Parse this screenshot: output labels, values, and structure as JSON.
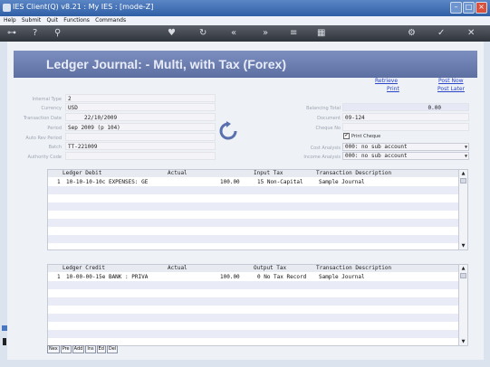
{
  "window": {
    "title": "IES Client(Q) v8.21 : My IES :      [mode-Z]"
  },
  "menu": [
    "Help",
    "Submit",
    "Quit",
    "Functions",
    "Commands"
  ],
  "page": {
    "title": "Ledger Journal: - Multi, with Tax (Forex)"
  },
  "links": {
    "retrieve": "Retrieve",
    "print": "Print",
    "post_now": "Post Now",
    "post_later": "Post Later"
  },
  "form": {
    "internal_type": {
      "label": "Internal Type",
      "value": "2"
    },
    "currency": {
      "label": "Currency",
      "value": "USD"
    },
    "transaction_date": {
      "label": "Transaction Date",
      "value": "22/10/2009"
    },
    "period": {
      "label": "Period",
      "value": "Sep 2009 (p 104)"
    },
    "auto_rev_period": {
      "label": "Auto Rev Period",
      "value": ""
    },
    "batch": {
      "label": "Batch",
      "value": "TT-221009"
    },
    "authority_code": {
      "label": "Authority Code",
      "value": ""
    },
    "balancing_total": {
      "label": "Balancing Total",
      "value": "0.00"
    },
    "document": {
      "label": "Document",
      "value": "09-124"
    },
    "cheque_no": {
      "label": "Cheque No",
      "value": ""
    },
    "print_cheque": {
      "label": "Print Cheque",
      "checked": true,
      "mark": "✔"
    },
    "cost_analysis": {
      "label": "Cost Analysis",
      "value": "000: no sub account"
    },
    "income_analysis": {
      "label": "Income Analysis",
      "value": "000: no sub account"
    }
  },
  "debit_grid": {
    "headers": {
      "ledger": "Ledger Debit",
      "actual": "Actual",
      "tax": "Input Tax",
      "desc": "Transaction Description"
    },
    "rows": [
      {
        "num": "1",
        "ledger": "10-10-10-10c EXPENSES: GE",
        "actual": "100.00",
        "tax": "15 Non-Capital",
        "desc": "Sample Journal"
      }
    ]
  },
  "credit_grid": {
    "headers": {
      "ledger": "Ledger Credit",
      "actual": "Actual",
      "tax": "Output Tax",
      "desc": "Transaction Description"
    },
    "rows": [
      {
        "num": "1",
        "ledger": "10-00-00-15e BANK : PRIVA",
        "actual": "100.00",
        "tax": "0 No Tax Record",
        "desc": "Sample Journal"
      }
    ]
  },
  "nav_buttons": [
    "Nex",
    "Pre",
    "Add",
    "Ins",
    "Ed",
    "Del"
  ],
  "colors": {
    "banner": "#6a7cb0",
    "link": "#2a44c8",
    "titlebar": "#3a6bb5"
  }
}
